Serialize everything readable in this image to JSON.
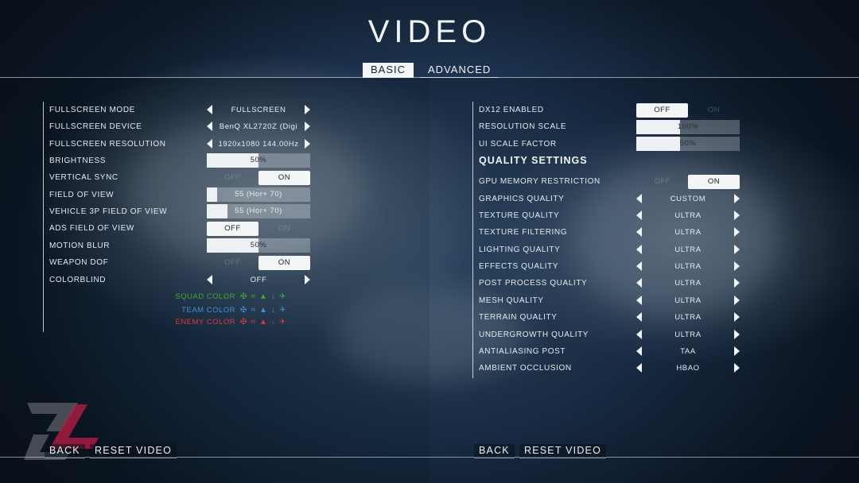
{
  "title": "VIDEO",
  "tabs": [
    {
      "label": "BASIC",
      "active": true
    },
    {
      "label": "ADVANCED",
      "active": false
    }
  ],
  "left": {
    "fullscreen_mode": {
      "label": "FULLSCREEN MODE",
      "value": "FULLSCREEN"
    },
    "fullscreen_device": {
      "label": "FULLSCREEN DEVICE",
      "value": "BenQ XL2720Z (Digi"
    },
    "fullscreen_resolution": {
      "label": "FULLSCREEN RESOLUTION",
      "value": "1920x1080 144.00Hz"
    },
    "brightness": {
      "label": "BRIGHTNESS",
      "value": "50%",
      "fraction": 0.5
    },
    "vertical_sync": {
      "label": "VERTICAL SYNC",
      "off": "OFF",
      "on": "ON",
      "selected": "on"
    },
    "field_of_view": {
      "label": "FIELD OF VIEW",
      "value": "55 (Hor+ 70)",
      "fraction": 0.1
    },
    "vehicle_fov": {
      "label": "VEHICLE 3P FIELD OF VIEW",
      "value": "55 (Hor+ 70)",
      "fraction": 0.2
    },
    "ads_fov": {
      "label": "ADS FIELD OF VIEW",
      "off": "OFF",
      "on": "ON",
      "selected": "off"
    },
    "motion_blur": {
      "label": "MOTION BLUR",
      "value": "50%",
      "fraction": 0.5
    },
    "weapon_dof": {
      "label": "WEAPON DOF",
      "off": "OFF",
      "on": "ON",
      "selected": "on"
    },
    "colorblind": {
      "label": "COLORBLIND",
      "value": "OFF"
    },
    "colors": {
      "squad": {
        "label": "SQUAD COLOR",
        "color": "#3fa83a"
      },
      "team": {
        "label": "TEAM COLOR",
        "color": "#3f8fd8"
      },
      "enemy": {
        "label": "ENEMY COLOR",
        "color": "#d63a3a"
      }
    },
    "buttons": {
      "back": "BACK",
      "reset": "RESET VIDEO"
    }
  },
  "right": {
    "dx12": {
      "label": "DX12 ENABLED",
      "off": "OFF",
      "on": "ON",
      "selected": "off"
    },
    "resolution_scale": {
      "label": "RESOLUTION SCALE",
      "value": "100%",
      "fraction": 0.42
    },
    "ui_scale": {
      "label": "UI SCALE FACTOR",
      "value": "50%",
      "fraction": 0.42
    },
    "quality_heading": "QUALITY SETTINGS",
    "gpu_memory": {
      "label": "GPU MEMORY RESTRICTION",
      "off": "OFF",
      "on": "ON",
      "selected": "on"
    },
    "graphics_quality": {
      "label": "GRAPHICS QUALITY",
      "value": "CUSTOM"
    },
    "texture_quality": {
      "label": "TEXTURE QUALITY",
      "value": "ULTRA"
    },
    "texture_filtering": {
      "label": "TEXTURE FILTERING",
      "value": "ULTRA"
    },
    "lighting_quality": {
      "label": "LIGHTING QUALITY",
      "value": "ULTRA"
    },
    "effects_quality": {
      "label": "EFFECTS QUALITY",
      "value": "ULTRA"
    },
    "post_process": {
      "label": "POST PROCESS QUALITY",
      "value": "ULTRA"
    },
    "mesh_quality": {
      "label": "MESH QUALITY",
      "value": "ULTRA"
    },
    "terrain_quality": {
      "label": "TERRAIN QUALITY",
      "value": "ULTRA"
    },
    "undergrowth_quality": {
      "label": "UNDERGROWTH QUALITY",
      "value": "ULTRA"
    },
    "antialiasing": {
      "label": "ANTIALIASING POST",
      "value": "TAA"
    },
    "ambient_occlusion": {
      "label": "AMBIENT OCCLUSION",
      "value": "HBAO"
    },
    "buttons": {
      "back": "BACK",
      "reset": "RESET VIDEO"
    }
  }
}
